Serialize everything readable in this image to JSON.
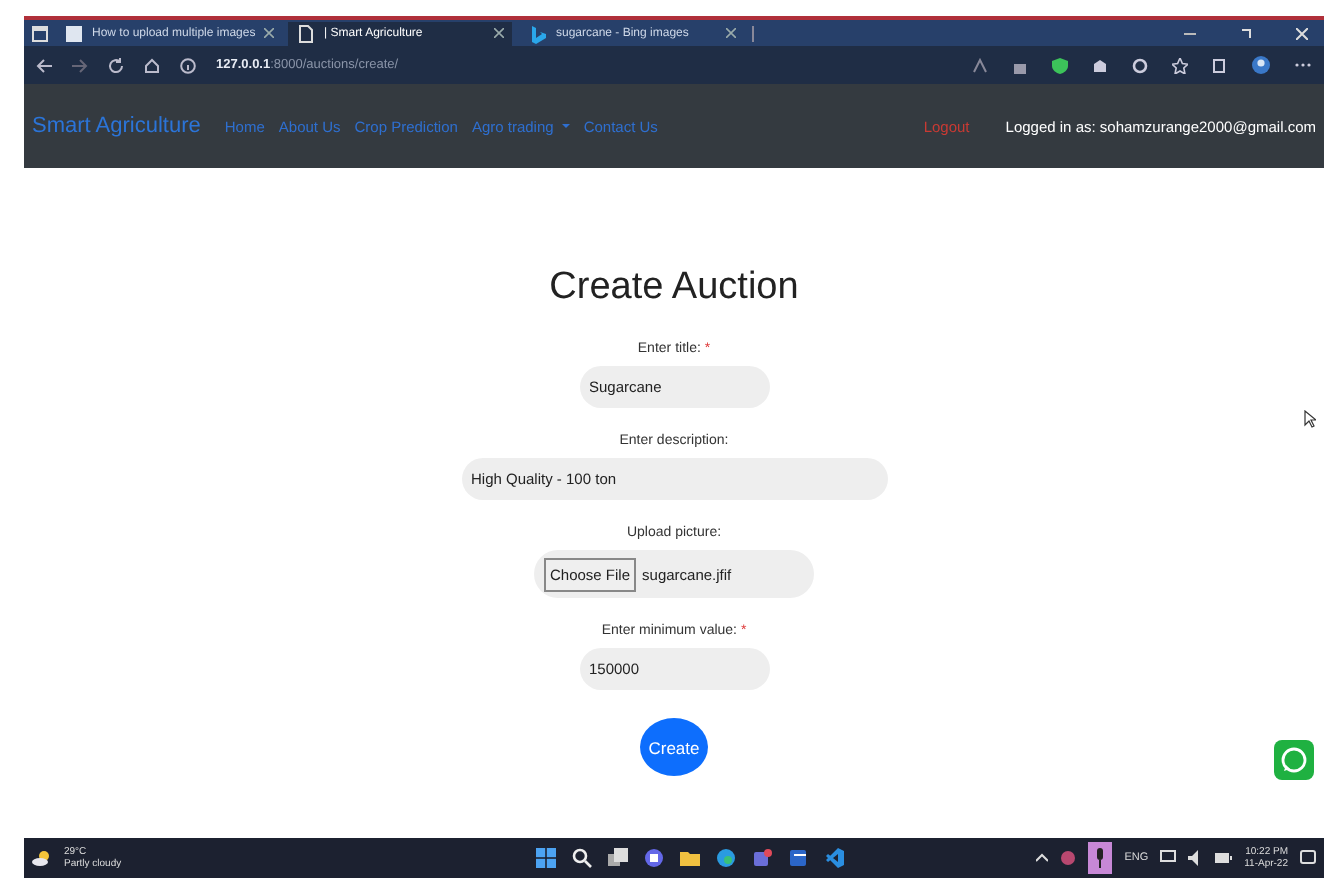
{
  "browser": {
    "tabs": [
      {
        "title": "How to upload multiple images",
        "selected": false,
        "kind": "page"
      },
      {
        "title": "| Smart Agriculture",
        "selected": true,
        "kind": "blank"
      },
      {
        "title": "sugarcane - Bing images",
        "selected": false,
        "kind": "bing"
      }
    ],
    "url_host": "127.0.0.1",
    "url_path": ":8000/auctions/create/"
  },
  "navbar": {
    "brand": "Smart Agriculture",
    "links": [
      {
        "label": "Home",
        "dropdown": false
      },
      {
        "label": "About Us",
        "dropdown": false
      },
      {
        "label": "Crop Prediction",
        "dropdown": false
      },
      {
        "label": "Agro trading",
        "dropdown": true
      },
      {
        "label": "Contact Us",
        "dropdown": false
      }
    ],
    "logout": "Logout",
    "user": "Logged in as: sohamzurange2000@gmail.com"
  },
  "form": {
    "heading": "Create Auction",
    "fields": [
      {
        "kind": "text",
        "label": "Enter title:",
        "required_mark": "*",
        "value": "Sugarcane"
      },
      {
        "kind": "text",
        "label": "Enter description:",
        "value": "High Quality - 100 ton"
      },
      {
        "kind": "file",
        "label": "Upload picture:",
        "button": "Choose File",
        "value": "sugarcane.jfif"
      },
      {
        "kind": "text",
        "label": "Enter minimum value:",
        "required_mark": "*",
        "value": "150000"
      }
    ],
    "submit": "Create"
  },
  "taskbar": {
    "temperature": "29°C",
    "weather": "Partly cloudy",
    "language": "ENG",
    "time": "10:22 PM",
    "date": "11-Apr-22"
  }
}
